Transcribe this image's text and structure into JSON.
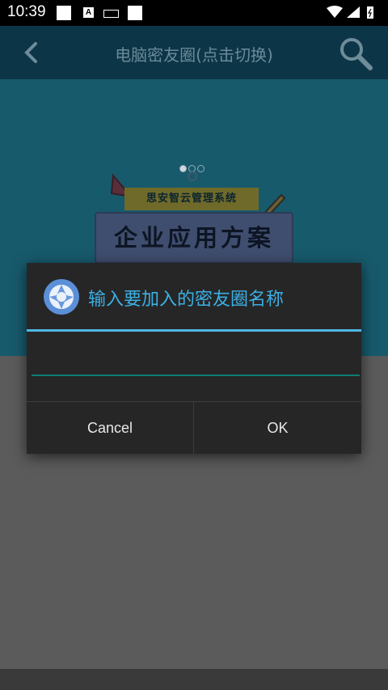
{
  "status_bar": {
    "time": "10:39",
    "icons": [
      "square-icon",
      "square-icon",
      "a-icon",
      "keyboard-icon",
      "square-icon",
      "wifi-icon",
      "signal-icon",
      "battery-icon"
    ]
  },
  "app_bar": {
    "title": "电脑密友圈(点击切换)",
    "back_icon": "chevron-left-icon",
    "search_icon": "search-icon"
  },
  "banner": {
    "subtitle": "思安智云管理系统",
    "main_text": "企业应用方案",
    "page_count": 3,
    "active_page": 1
  },
  "dialog": {
    "icon": "aperture-icon",
    "title": "输入要加入的密友圈名称",
    "input_value": "",
    "input_placeholder": "",
    "cancel_label": "Cancel",
    "ok_label": "OK"
  },
  "colors": {
    "dialog_title": "#3bb0e6",
    "accent_line": "#4fb7e6",
    "input_underline": "#0d7d77",
    "dialog_bg": "#262626"
  }
}
